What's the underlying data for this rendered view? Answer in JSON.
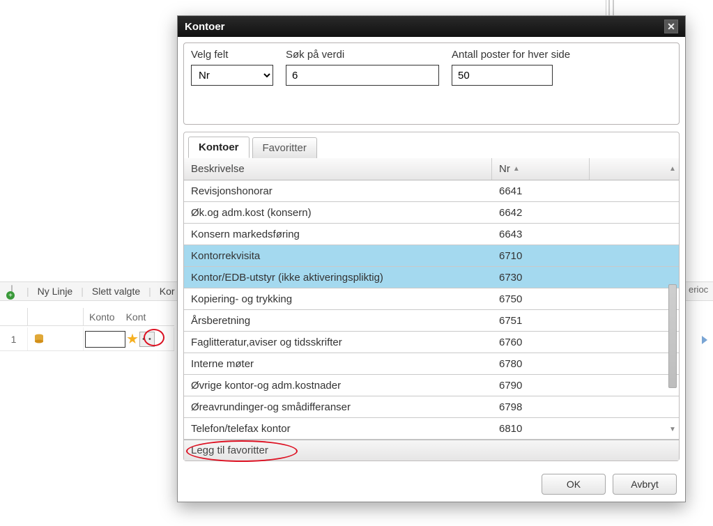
{
  "modal": {
    "title": "Kontoer",
    "filters": {
      "field_label": "Velg felt",
      "field_value": "Nr",
      "search_label": "Søk på verdi",
      "search_value": "6",
      "page_label": "Antall poster for hver side",
      "page_value": "50"
    },
    "tabs": {
      "kontoer": "Kontoer",
      "favoritter": "Favoritter"
    },
    "columns": {
      "beskrivelse": "Beskrivelse",
      "nr": "Nr"
    },
    "rows": [
      {
        "beskrivelse": "Revisjonshonorar",
        "nr": "6641",
        "selected": false
      },
      {
        "beskrivelse": "Øk.og adm.kost (konsern)",
        "nr": "6642",
        "selected": false
      },
      {
        "beskrivelse": "Konsern markedsføring",
        "nr": "6643",
        "selected": false
      },
      {
        "beskrivelse": "Kontorrekvisita",
        "nr": "6710",
        "selected": true
      },
      {
        "beskrivelse": "Kontor/EDB-utstyr (ikke aktiveringspliktig)",
        "nr": "6730",
        "selected": true
      },
      {
        "beskrivelse": "Kopiering- og trykking",
        "nr": "6750",
        "selected": false
      },
      {
        "beskrivelse": "Årsberetning",
        "nr": "6751",
        "selected": false
      },
      {
        "beskrivelse": "Faglitteratur,aviser og tidsskrifter",
        "nr": "6760",
        "selected": false
      },
      {
        "beskrivelse": "Interne møter",
        "nr": "6780",
        "selected": false
      },
      {
        "beskrivelse": "Øvrige kontor-og adm.kostnader",
        "nr": "6790",
        "selected": false
      },
      {
        "beskrivelse": "Øreavrundinger-og smådifferanser",
        "nr": "6798",
        "selected": false
      },
      {
        "beskrivelse": "Telefon/telefax kontor",
        "nr": "6810",
        "selected": false
      }
    ],
    "add_favorites": "Legg til favoritter",
    "buttons": {
      "ok": "OK",
      "cancel": "Avbryt"
    }
  },
  "background": {
    "toolbar": {
      "new_line": "Ny Linje",
      "delete": "Slett valgte",
      "kon_cut": "Kor"
    },
    "grid": {
      "col_konto": "Konto",
      "col_kont": "Kont",
      "row_num": "1"
    },
    "right": {
      "label": "erioc"
    }
  }
}
